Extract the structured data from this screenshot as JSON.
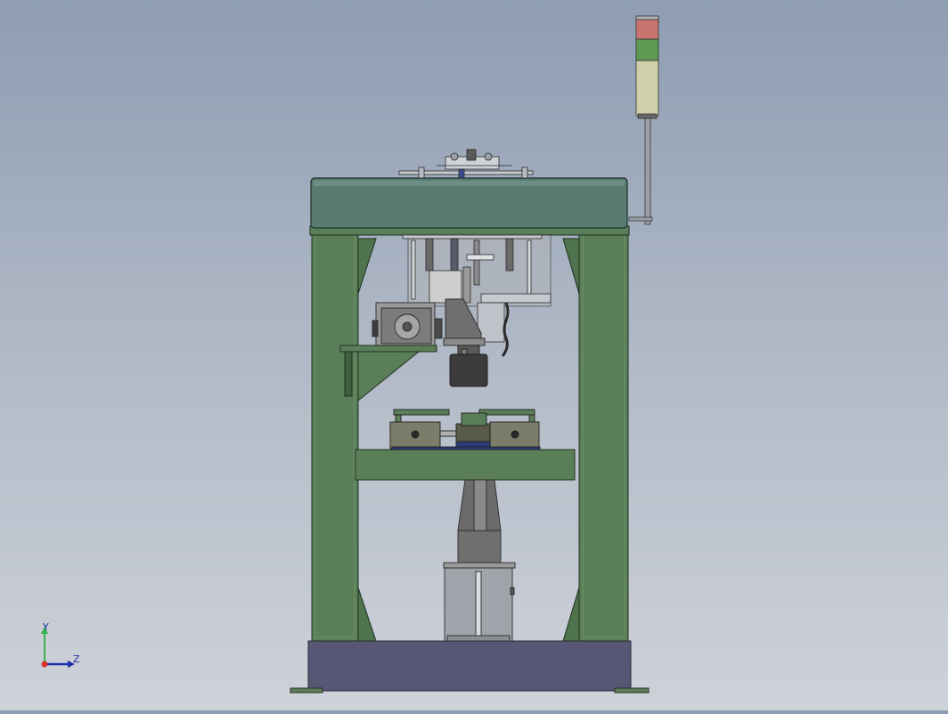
{
  "viewport": {
    "background_top": "#8e9db2",
    "background_bottom": "#ced2d9",
    "model_colors": {
      "frame_green": "#5a7f58",
      "frame_green_dark": "#3f5f3f",
      "top_cover": "#587c72",
      "base_plate": "#575775",
      "motor_grey": "#8c8c8c",
      "dark_part": "#3c3c3c",
      "stack_red": "#c9746f",
      "stack_green": "#5e9a52",
      "stack_amber": "#cdd0a8"
    }
  },
  "axis_triad": {
    "y_label": "Y",
    "z_label": "Z",
    "y_color": "#36b34a",
    "z_color": "#1c2ea8",
    "x_color": "#d9342b"
  }
}
